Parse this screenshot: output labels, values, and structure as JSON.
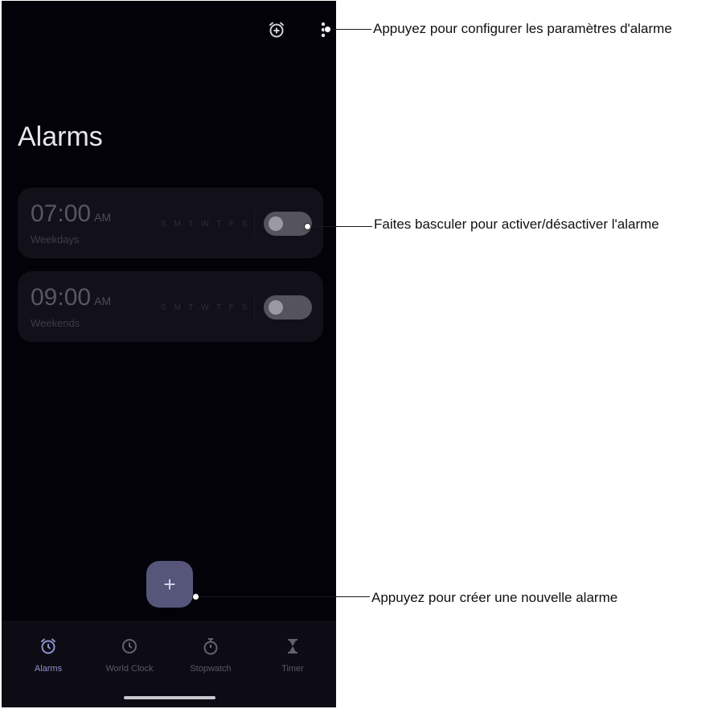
{
  "header": {
    "title": "Alarms",
    "icons": [
      "alarm-add-icon",
      "more-vert-icon"
    ]
  },
  "alarms": [
    {
      "time": "07:00",
      "ampm": "AM",
      "label": "Weekdays",
      "days": "S M T W T F S",
      "enabled": false
    },
    {
      "time": "09:00",
      "ampm": "AM",
      "label": "Weekends",
      "days": "S M T W T F S",
      "enabled": false
    }
  ],
  "fab": {
    "label": "+"
  },
  "nav": {
    "items": [
      {
        "label": "Alarms",
        "icon": "alarm-clock-icon",
        "active": true
      },
      {
        "label": "World Clock",
        "icon": "clock-icon",
        "active": false
      },
      {
        "label": "Stopwatch",
        "icon": "stopwatch-icon",
        "active": false
      },
      {
        "label": "Timer",
        "icon": "hourglass-icon",
        "active": false
      }
    ]
  },
  "annotations": {
    "settings": "Appuyez pour configurer les paramètres d'alarme",
    "toggle": "Faites basculer pour activer/désactiver l'alarme",
    "create": "Appuyez pour créer une nouvelle alarme"
  },
  "colors": {
    "background": "#030208",
    "card": "#121119",
    "accent": "#8e92cd",
    "fab": "#55567a"
  }
}
